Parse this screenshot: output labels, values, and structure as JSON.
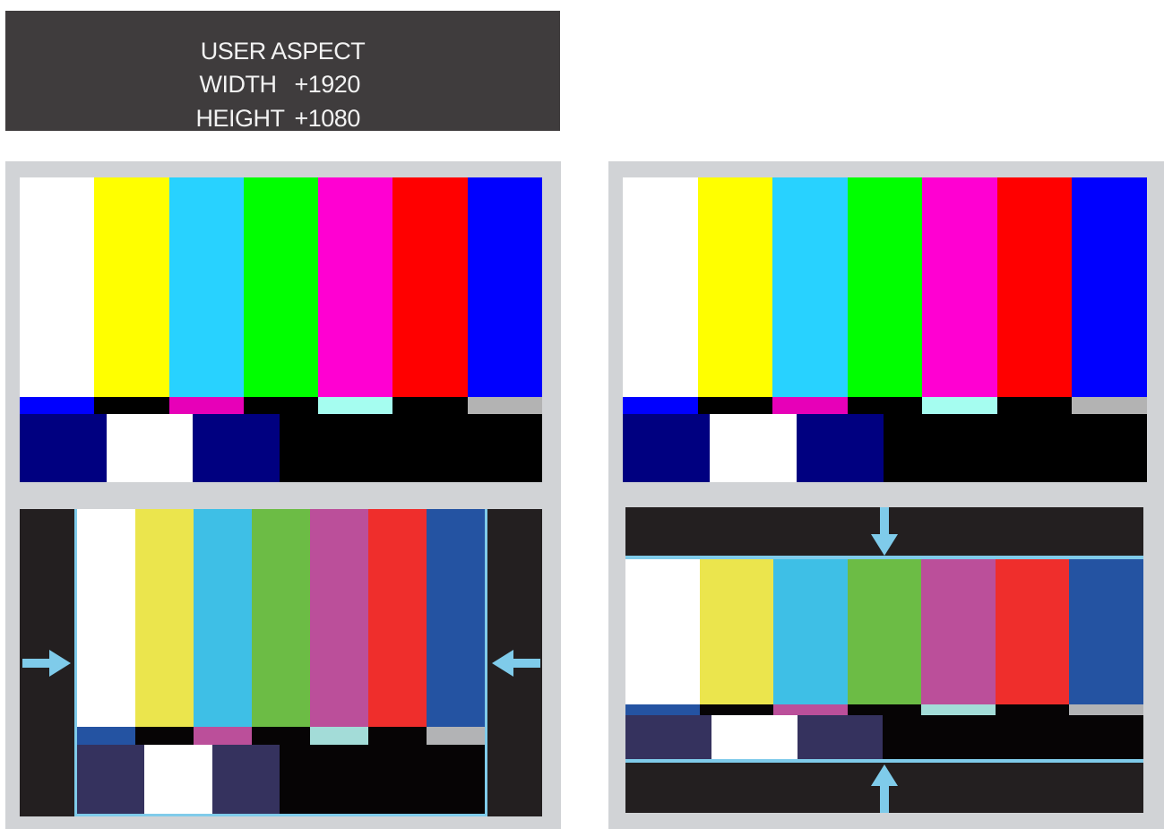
{
  "osd": {
    "title": "USER ASPECT",
    "width_label": "WIDTH",
    "width_value": "+1920",
    "height_label": "HEIGHT",
    "height_value": "+1080"
  },
  "bar_colors": [
    "#ffffff",
    "#ffff00",
    "#28d2ff",
    "#00ff00",
    "#ff00d2",
    "#ff0000",
    "#0000ff"
  ],
  "castellation_colors": [
    "#0000ff",
    "#000000",
    "#e700b8",
    "#000000",
    "#a5fdf0",
    "#000000",
    "#b3b3b3"
  ],
  "pluge_colors": [
    "#000080",
    "#ffffff",
    "#000080",
    "#000000"
  ],
  "adjusted_bar_colors": [
    "#ffffff",
    "#ebe54d",
    "#3ebfe6",
    "#6cbc45",
    "#bb4f9a",
    "#ef2e2c",
    "#2453a2"
  ],
  "adjusted_castellation_colors": [
    "#2453a2",
    "#060405",
    "#bb4f9a",
    "#060405",
    "#a3dcd8",
    "#060405",
    "#b2b3b5"
  ],
  "adjusted_pluge_colors": [
    "#35325e",
    "#ffffff",
    "#35325e",
    "#060405"
  ],
  "colors": {
    "osd_background": "#3f3c3d",
    "panel_background": "#d1d3d6",
    "letterbox": "#231f20",
    "guide_line": "#7fcbea"
  },
  "icons": [
    "arrow-right-icon",
    "arrow-left-icon",
    "arrow-down-icon",
    "arrow-up-icon"
  ]
}
